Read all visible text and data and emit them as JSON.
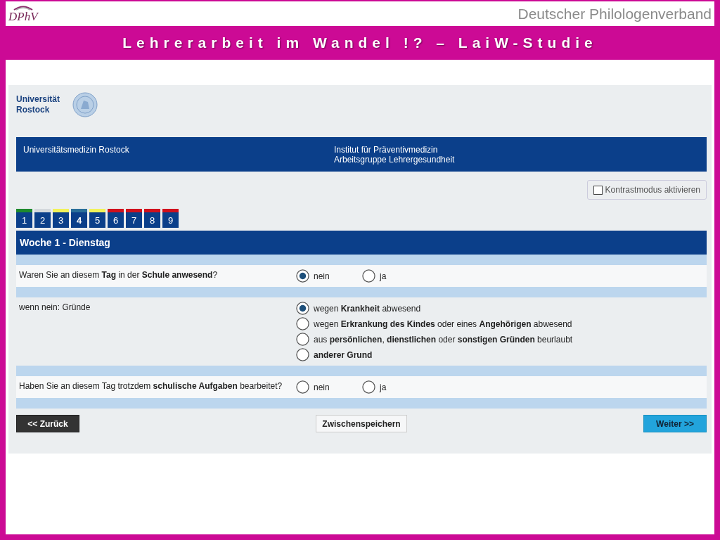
{
  "slide_header": {
    "logo": "DPhV",
    "organization": "Deutscher Philologenverband",
    "title": "Lehrerarbeit im Wandel !? – LaiW-Studie"
  },
  "university": {
    "name_line1": "Universität",
    "name_line2": "Rostock"
  },
  "banner": {
    "left": "Universitätsmedizin Rostock",
    "right_line1": "Institut für Präventivmedizin",
    "right_line2": "Arbeitsgruppe Lehrergesundheit"
  },
  "contrast_mode": {
    "label": "Kontrastmodus aktivieren",
    "checked": false
  },
  "day_tabs": [
    {
      "label": "1",
      "selected": false,
      "color": "#1e8a2e"
    },
    {
      "label": "2",
      "selected": false,
      "color": "#d4d8dc"
    },
    {
      "label": "3",
      "selected": false,
      "color": "#f2f25a"
    },
    {
      "label": "4",
      "selected": true,
      "color": "#2a6f9a"
    },
    {
      "label": "5",
      "selected": false,
      "color": "#f2f25a"
    },
    {
      "label": "6",
      "selected": false,
      "color": "#d0101c"
    },
    {
      "label": "7",
      "selected": false,
      "color": "#d0101c"
    },
    {
      "label": "8",
      "selected": false,
      "color": "#d0101c"
    },
    {
      "label": "9",
      "selected": false,
      "color": "#d0101c"
    }
  ],
  "section_title": "Woche 1 - Dienstag",
  "questions": [
    {
      "text": "Waren Sie an diesem **Tag** in der **Schule anwesend**?",
      "kind": "inline",
      "options": [
        {
          "label": "nein",
          "selected": true
        },
        {
          "label": "ja",
          "selected": false
        }
      ]
    },
    {
      "text": "wenn nein: Gründe",
      "kind": "stacked",
      "options": [
        {
          "label": "wegen **Krankheit** abwesend",
          "selected": true
        },
        {
          "label": "wegen **Erkrankung des Kindes** oder eines **Angehörigen** abwesend",
          "selected": false
        },
        {
          "label": "aus **persönlichen**, **dienstlichen** oder **sonstigen Gründen** beurlaubt",
          "selected": false
        },
        {
          "label": "**anderer Grund**",
          "selected": false
        }
      ]
    },
    {
      "text": "Haben Sie an diesem Tag trotzdem **schulische Aufgaben** bearbeitet?",
      "kind": "inline",
      "options": [
        {
          "label": "nein",
          "selected": false
        },
        {
          "label": "ja",
          "selected": false
        }
      ]
    }
  ],
  "buttons": {
    "back": "<< Zurück",
    "save": "Zwischenspeichern",
    "next": "Weiter >>"
  }
}
